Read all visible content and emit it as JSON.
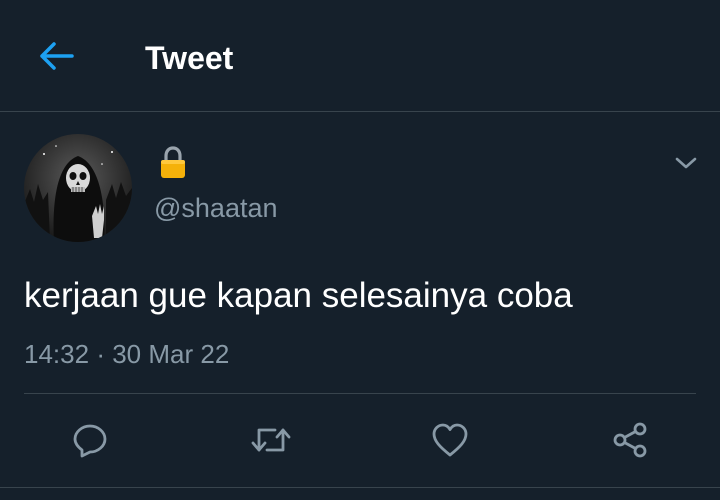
{
  "header": {
    "title": "Tweet",
    "back_icon": "arrow-left-icon"
  },
  "tweet": {
    "author": {
      "lock_icon": "lock-icon",
      "handle": "@shaatan"
    },
    "text": "kerjaan gue kapan selesainya coba",
    "time": "14:32",
    "separator": "·",
    "date": "30 Mar 22",
    "more_icon": "chevron-down-icon"
  },
  "actions": [
    {
      "icon": "reply-icon"
    },
    {
      "icon": "retweet-icon"
    },
    {
      "icon": "like-icon"
    },
    {
      "icon": "share-icon"
    }
  ],
  "colors": {
    "background": "#15202b",
    "accent": "#1da1f2",
    "secondary_text": "#8899a6",
    "divider": "#38444d"
  }
}
